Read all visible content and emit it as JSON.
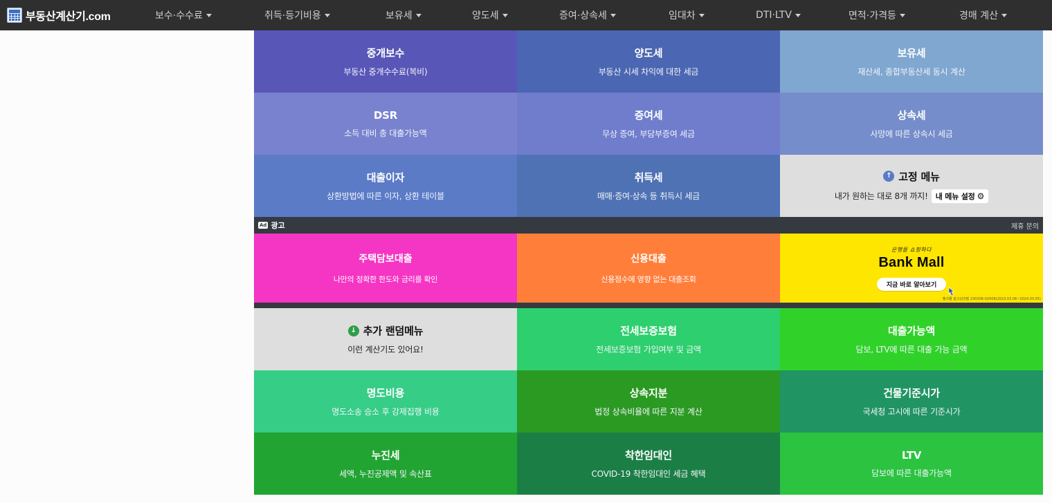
{
  "colors": {
    "navbar_bg": "#2f2f2f",
    "ad_bar_bg": "#343a40"
  },
  "brand": {
    "name": "부동산계산기.com",
    "icon": "calculator-icon"
  },
  "nav": {
    "items": [
      {
        "label": "보수·수수료"
      },
      {
        "label": "취득·등기비용"
      },
      {
        "label": "보유세"
      },
      {
        "label": "양도세"
      },
      {
        "label": "증여·상속세"
      },
      {
        "label": "임대차"
      },
      {
        "label": "DTI·LTV"
      },
      {
        "label": "면적·가격등"
      },
      {
        "label": "경매 계산"
      }
    ]
  },
  "tiles_top": [
    {
      "title": "중개보수",
      "desc": "부동산 중개수수료(복비)",
      "color": "#5856b7"
    },
    {
      "title": "양도세",
      "desc": "부동산 시세 차익에 대한 세금",
      "color": "#4b66b2"
    },
    {
      "title": "보유세",
      "desc": "재산세, 종합부동산세 동시 계산",
      "color": "#7fa7d0"
    },
    {
      "title": "DSR",
      "desc": "소득 대비 총 대출가능액",
      "color": "#7882ce"
    },
    {
      "title": "증여세",
      "desc": "무상 증여, 부담부증여 세금",
      "color": "#6f7dcc"
    },
    {
      "title": "상속세",
      "desc": "사망에 따른 상속시 세금",
      "color": "#758dca"
    },
    {
      "title": "대출이자",
      "desc": "상환방법에 따른 이자, 상환 테이블",
      "color": "#5b7bc7"
    },
    {
      "title": "취득세",
      "desc": "매매·증여·상속 등 취득시 세금",
      "color": "#4f72b4"
    }
  ],
  "fixed_menu": {
    "title": "고정 메뉴",
    "desc": "내가 원하는 대로 8개 까지!",
    "button": "내 메뉴 설정",
    "icon": "arrow-up-circle-icon",
    "button_icon": "gear-icon",
    "color": "#dedede",
    "icon_color": "#5b7bc7"
  },
  "ad": {
    "label": "광고",
    "badge": "Ad",
    "contact": "제휴 문의",
    "tiles": [
      {
        "title": "주택담보대출",
        "desc": "나만의 정확한 한도와 금리를 확인",
        "color": "#f535c3"
      },
      {
        "title": "신용대출",
        "desc": "신용점수에 영향 없는 대출조회",
        "color": "#ff7e3a"
      }
    ],
    "bank": {
      "slogan": "은행을 쇼핑하다",
      "name": "Bank Mall",
      "cta": "지금 바로 알아보기",
      "fine_print": "뱅크몰 광고심의필 230306-02008(2023.03.06~2024.03.05)",
      "color": "#ffe600"
    }
  },
  "random_menu": {
    "title": "추가 랜덤메뉴",
    "desc": "이런 계산기도 있어요!",
    "icon": "arrow-down-circle-icon",
    "color": "#dedede",
    "icon_color": "#2e9e4a"
  },
  "tiles_bottom": [
    {
      "title": "전세보증보험",
      "desc": "전세보증보험 가입여부 및 금액",
      "color": "#2ecf6e"
    },
    {
      "title": "대출가능액",
      "desc": "담보, LTV에 따른 대출 가능 금액",
      "color": "#30d22a"
    },
    {
      "title": "명도비용",
      "desc": "명도소송 승소 후 강제집행 비용",
      "color": "#36cd87"
    },
    {
      "title": "상속지분",
      "desc": "법정 상속비율에 따른 지분 계산",
      "color": "#2b9a22"
    },
    {
      "title": "건물기준시가",
      "desc": "국세청 고시에 따른 기준시가",
      "color": "#219463"
    },
    {
      "title": "누진세",
      "desc": "세액, 누진공제액 및 속산표",
      "color": "#22a433"
    },
    {
      "title": "착한임대인",
      "desc": "COVID-19 착한임대인 세금 혜택",
      "color": "#1b7f45"
    },
    {
      "title": "LTV",
      "desc": "담보에 따른 대출가능액",
      "color": "#2bc33f"
    }
  ]
}
